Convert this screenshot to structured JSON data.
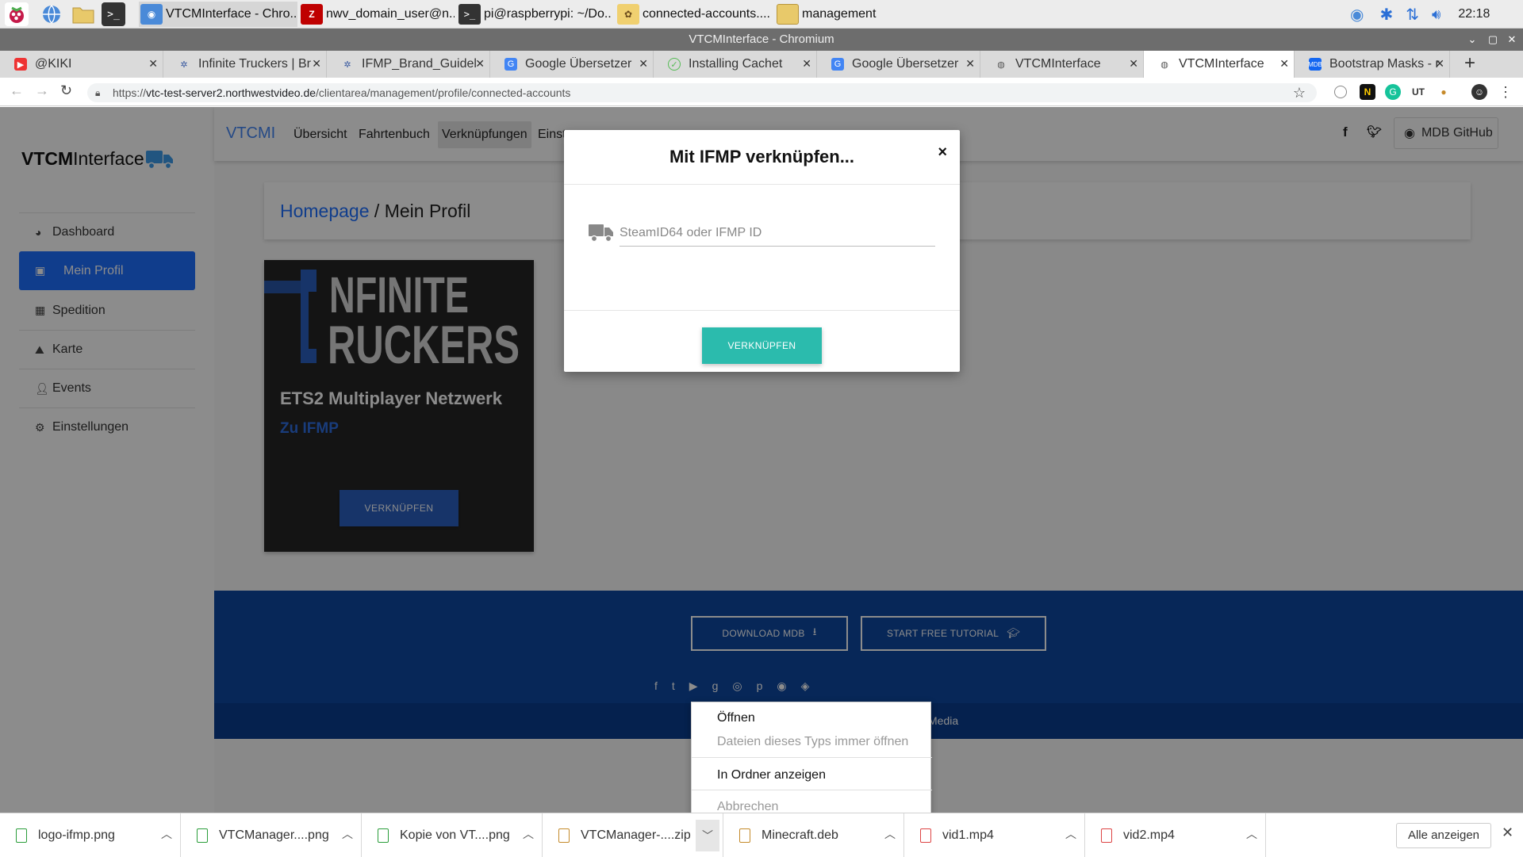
{
  "taskbar": {
    "tasks": [
      {
        "label": "VTCMInterface - Chro...",
        "icon": "chromium-icon"
      },
      {
        "label": "nwv_domain_user@n...",
        "icon": "filezilla-icon"
      },
      {
        "label": "pi@raspberrypi: ~/Do...",
        "icon": "terminal-icon"
      },
      {
        "label": "connected-accounts....",
        "icon": "gimp-icon"
      },
      {
        "label": "management",
        "icon": "folder-icon"
      }
    ],
    "clock": "22:18"
  },
  "window": {
    "title": "VTCMInterface - Chromium"
  },
  "tabs": [
    {
      "label": "@KIKI",
      "favicon": "youtube-icon"
    },
    {
      "label": "Infinite Truckers | Br",
      "favicon": "ifmp-icon"
    },
    {
      "label": "IFMP_Brand_Guidel",
      "favicon": "ifmp-icon"
    },
    {
      "label": "Google Übersetzer",
      "favicon": "translate-icon"
    },
    {
      "label": "Installing Cachet",
      "favicon": "check-icon"
    },
    {
      "label": "Google Übersetzer",
      "favicon": "translate-icon"
    },
    {
      "label": "VTCMInterface",
      "favicon": "globe-icon"
    },
    {
      "label": "VTCMInterface",
      "favicon": "globe-icon"
    },
    {
      "label": "Bootstrap Masks - r",
      "favicon": "mdb-icon"
    }
  ],
  "address": {
    "scheme": "https://",
    "host": "vtc-test-server2.northwestvideo.de",
    "path": "/clientarea/management/profile/connected-accounts"
  },
  "sidebar": {
    "logo_bold": "VTCM",
    "logo_rest": "Interface",
    "items": [
      {
        "label": "Dashboard",
        "icon": "chart-pie-icon"
      },
      {
        "label": "Mein Profil",
        "icon": "id-card-icon"
      },
      {
        "label": "Spedition",
        "icon": "building-icon"
      },
      {
        "label": "Karte",
        "icon": "map-icon"
      },
      {
        "label": "Events",
        "icon": "user-icon"
      },
      {
        "label": "Einstellungen",
        "icon": "gear-icon"
      }
    ]
  },
  "navbar": {
    "brand": "VTCMI",
    "links": [
      "Übersicht",
      "Fahrtenbuch",
      "Verknüpfungen",
      "Einst..."
    ],
    "github": "MDB GitHub"
  },
  "breadcrumb": {
    "home": "Homepage",
    "separator": " / ",
    "current": "Mein Profil"
  },
  "card": {
    "logo_line1": "NFINITE",
    "logo_line2": "RUCKERS",
    "title": "ETS2 Multiplayer Netzwerk",
    "link": "Zu IFMP",
    "button": "VERKNÜPFEN"
  },
  "footer": {
    "download_btn": "DOWNLOAD MDB",
    "tutorial_btn": "START FREE TUTORIAL",
    "copyright_tail": "Media"
  },
  "modal": {
    "title": "Mit IFMP verknüpfen...",
    "close": "×",
    "input_placeholder": "SteamID64 oder IFMP ID",
    "input_value": "",
    "button": "VERKNÜPFEN"
  },
  "context_menu": {
    "items": [
      {
        "label": "Öffnen",
        "enabled": true
      },
      {
        "label": "Dateien dieses Typs immer öffnen",
        "enabled": false
      },
      {
        "label": "In Ordner anzeigen",
        "enabled": true
      },
      {
        "label": "Abbrechen",
        "enabled": false
      }
    ]
  },
  "downloads": {
    "items": [
      {
        "name": "logo-ifmp.png",
        "type": "png"
      },
      {
        "name": "VTCManager....png",
        "type": "png"
      },
      {
        "name": "Kopie von VT....png",
        "type": "png"
      },
      {
        "name": "VTCManager-....zip",
        "type": "zip"
      },
      {
        "name": "Minecraft.deb",
        "type": "deb"
      },
      {
        "name": "vid1.mp4",
        "type": "vid"
      },
      {
        "name": "vid2.mp4",
        "type": "vid"
      }
    ],
    "show_all": "Alle anzeigen"
  },
  "colors": {
    "primary": "#1e6fff",
    "teal": "#2bbbad",
    "footer": "#0d47a1"
  }
}
